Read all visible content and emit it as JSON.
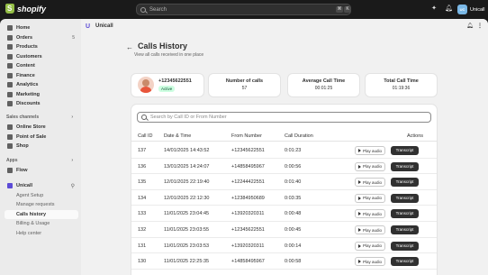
{
  "topbar": {
    "brand": "shopify",
    "search_placeholder": "Search",
    "shortcut_keys": [
      "⌘",
      "K"
    ],
    "store_initials": "Unicall",
    "store_name": "Unicall"
  },
  "sidebar": {
    "items": [
      {
        "label": "Home",
        "icon": "home-icon"
      },
      {
        "label": "Orders",
        "icon": "orders-icon",
        "badge": "5"
      },
      {
        "label": "Products",
        "icon": "tag-icon"
      },
      {
        "label": "Customers",
        "icon": "person-icon"
      },
      {
        "label": "Content",
        "icon": "content-icon"
      },
      {
        "label": "Finance",
        "icon": "bank-icon"
      },
      {
        "label": "Analytics",
        "icon": "chart-icon"
      },
      {
        "label": "Marketing",
        "icon": "target-icon"
      },
      {
        "label": "Discounts",
        "icon": "discount-icon"
      }
    ],
    "sales_channels_label": "Sales channels",
    "sales_channels": [
      {
        "label": "Online Store",
        "icon": "store-icon"
      },
      {
        "label": "Point of Sale",
        "icon": "pos-icon"
      },
      {
        "label": "Shop",
        "icon": "shop-icon"
      }
    ],
    "apps_label": "Apps",
    "apps": [
      {
        "label": "Flow",
        "icon": "flow-icon"
      }
    ],
    "unicall": {
      "label": "Unicall",
      "sub_items": [
        "Agent Setup",
        "Manage requests",
        "Calls history",
        "Billing & Usage",
        "Help center"
      ],
      "active": "Calls history"
    }
  },
  "app_header": {
    "name": "Unicall"
  },
  "page": {
    "title": "Calls History",
    "subtitle": "View all calls received in one place",
    "user": {
      "phone": "+12345622551",
      "status": "Active"
    },
    "stats": [
      {
        "label": "Number of calls",
        "value": "57"
      },
      {
        "label": "Average Call Time",
        "value": "00:01:25"
      },
      {
        "label": "Total Call Time",
        "value": "01:19:36"
      }
    ],
    "table": {
      "search_placeholder": "Search by Call ID or From Number",
      "columns": [
        "Call ID",
        "Date & Time",
        "From Number",
        "Call Duration",
        "Actions"
      ],
      "play_label": "Play audio",
      "transcript_label": "Transcript",
      "rows": [
        {
          "id": "137",
          "datetime": "14/01/2025 14:43:52",
          "from": "+12345622551",
          "duration": "0:01:23"
        },
        {
          "id": "136",
          "datetime": "13/01/2025 14:24:07",
          "from": "+14858495967",
          "duration": "0:00:56"
        },
        {
          "id": "135",
          "datetime": "12/01/2025 22:19:40",
          "from": "+12244422551",
          "duration": "0:01:40"
        },
        {
          "id": "134",
          "datetime": "12/01/2025 22:12:30",
          "from": "+12384950689",
          "duration": "0:03:35"
        },
        {
          "id": "133",
          "datetime": "11/01/2025 23:04:45",
          "from": "+13920320311",
          "duration": "0:00:48"
        },
        {
          "id": "132",
          "datetime": "11/01/2025 23:03:55",
          "from": "+12345622551",
          "duration": "0:00:45"
        },
        {
          "id": "131",
          "datetime": "11/01/2025 23:03:53",
          "from": "+13920320311",
          "duration": "0:00:14"
        },
        {
          "id": "130",
          "datetime": "11/01/2025 22:25:35",
          "from": "+14858495967",
          "duration": "0:00:58"
        }
      ]
    }
  }
}
